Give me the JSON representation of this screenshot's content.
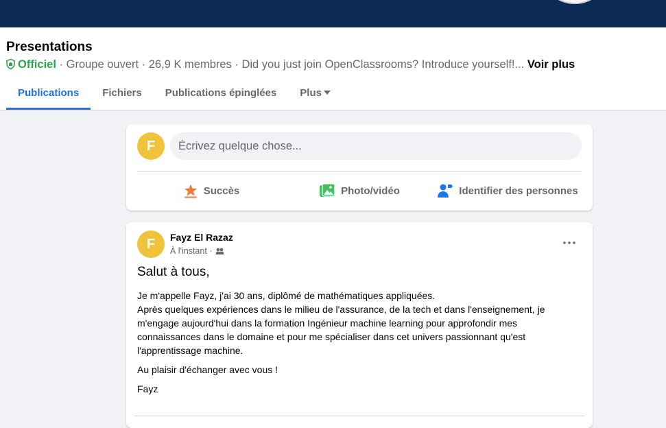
{
  "group": {
    "name": "Presentations",
    "badge": "Officiel",
    "meta_text": "· Groupe ouvert · 26,9 K membres · Did you just join OpenClassrooms? Introduce yourself!...",
    "see_more": "Voir plus",
    "colors": {
      "cover": "#0b2a55",
      "official": "#31a24c",
      "accent": "#1b74e4"
    }
  },
  "tabs": [
    {
      "label": "Publications",
      "active": true
    },
    {
      "label": "Fichiers"
    },
    {
      "label": "Publications épinglées"
    },
    {
      "label": "Plus"
    }
  ],
  "composer": {
    "avatar_initial": "F",
    "placeholder": "Écrivez quelque chose...",
    "actions": [
      {
        "label": "Succès",
        "icon": "star-icon",
        "color": "#f5793b"
      },
      {
        "label": "Photo/vidéo",
        "icon": "photo-icon",
        "color": "#45bd62"
      },
      {
        "label": "Identifier des personnes",
        "icon": "tag-people-icon",
        "color": "#1877f2"
      }
    ]
  },
  "post": {
    "avatar_initial": "F",
    "author": "Fayz El Razaz",
    "time": "À l'instant ·",
    "audience_icon": "group-icon",
    "menu_icon": "more-options-icon",
    "title": "Salut à tous,",
    "lines": [
      "Je m'appelle Fayz, j'ai 30 ans, diplômé de mathématiques appliquées.",
      "Après quelques expériences dans le milieu de l'assurance, de la tech et dans l'enseignement, je m'engage aujourd'hui dans la formation Ingénieur machine learning pour approfondir mes connaissances dans le domaine et pour me spécialiser dans cet univers passionnant qu'est l'apprentissage machine."
    ],
    "closing": "Au plaisir d'échanger avec vous !",
    "signature": "Fayz"
  }
}
